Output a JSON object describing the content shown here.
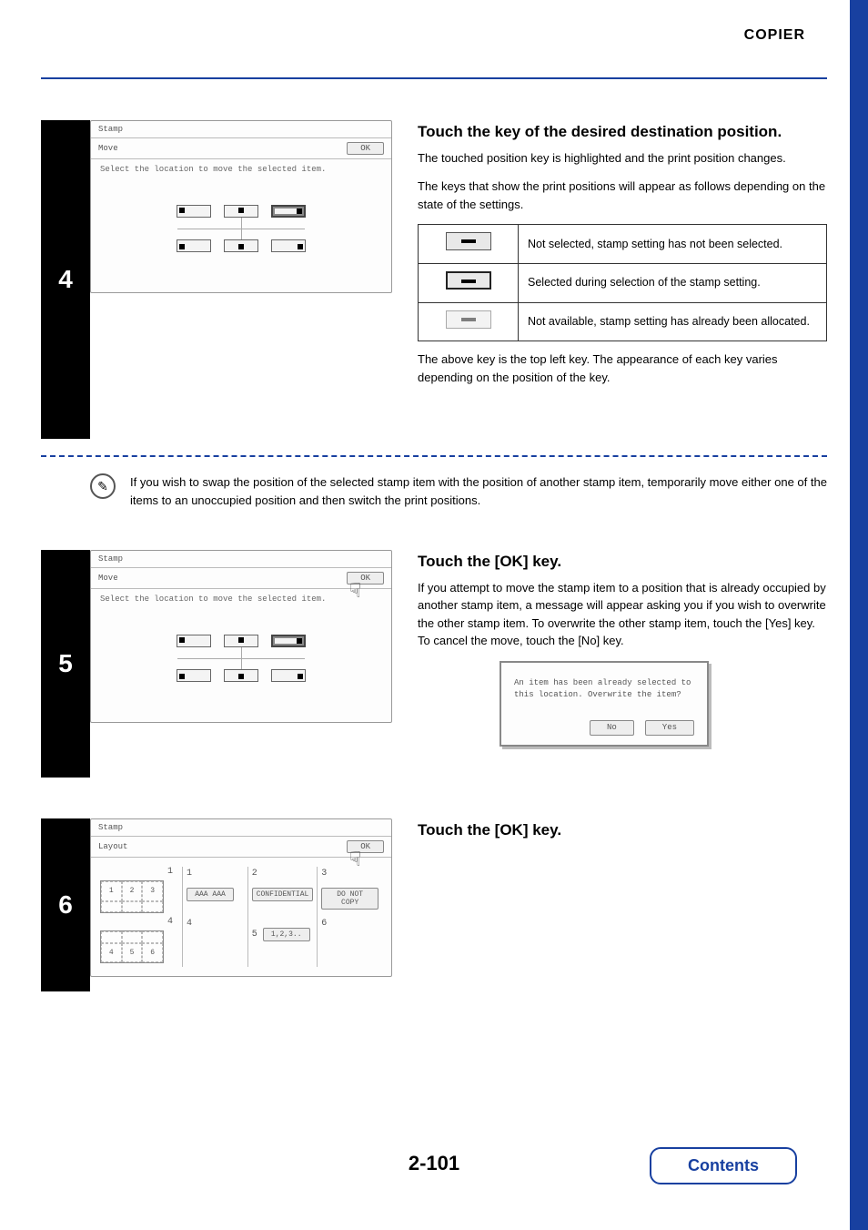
{
  "header": {
    "section": "COPIER"
  },
  "page_number": "2-101",
  "contents_label": "Contents",
  "note": {
    "text": "If you wish to swap the position of the selected stamp item with the position of another stamp item, temporarily move either one of the items to an unoccupied position and then switch the print positions."
  },
  "step4": {
    "num": "4",
    "title": "Touch the key of the desired destination position.",
    "p1": "The touched position key is highlighted and the print position changes.",
    "p2": "The keys that show the print positions will appear as follows depending on the state of the settings.",
    "footer": "The above key is the top left key. The appearance of each key varies depending on the position of the key.",
    "panel": {
      "title": "Stamp",
      "subtitle": "Move",
      "ok": "OK",
      "prompt": "Select the location to move the selected item."
    },
    "states": {
      "s1": "Not selected, stamp setting has not been selected.",
      "s2": "Selected during selection of the stamp setting.",
      "s3": "Not available, stamp setting has already been allocated."
    }
  },
  "step5": {
    "num": "5",
    "title": "Touch the [OK] key.",
    "body": "If you attempt to move the stamp item to a position that is already occupied by another stamp item, a message will appear asking you if you wish to overwrite the other stamp item. To overwrite the other stamp item, touch the [Yes] key. To cancel the move, touch the [No] key.",
    "panel": {
      "title": "Stamp",
      "subtitle": "Move",
      "ok": "OK",
      "prompt": "Select the location to move the selected item."
    },
    "dialog": {
      "msg1": "An item has been already selected to",
      "msg2": "this location. Overwrite the item?",
      "no": "No",
      "yes": "Yes"
    }
  },
  "step6": {
    "num": "6",
    "title": "Touch the [OK] key.",
    "panel": {
      "title": "Stamp",
      "subtitle": "Layout",
      "ok": "OK",
      "cells": {
        "c1": "1",
        "c2": "2",
        "c3": "3",
        "c4": "4",
        "c5": "5",
        "c6": "6",
        "b1": "AAA AAA",
        "b2": "CONFIDENTIAL",
        "b3": "DO NOT COPY",
        "b5": "1,2,3.."
      }
    }
  }
}
